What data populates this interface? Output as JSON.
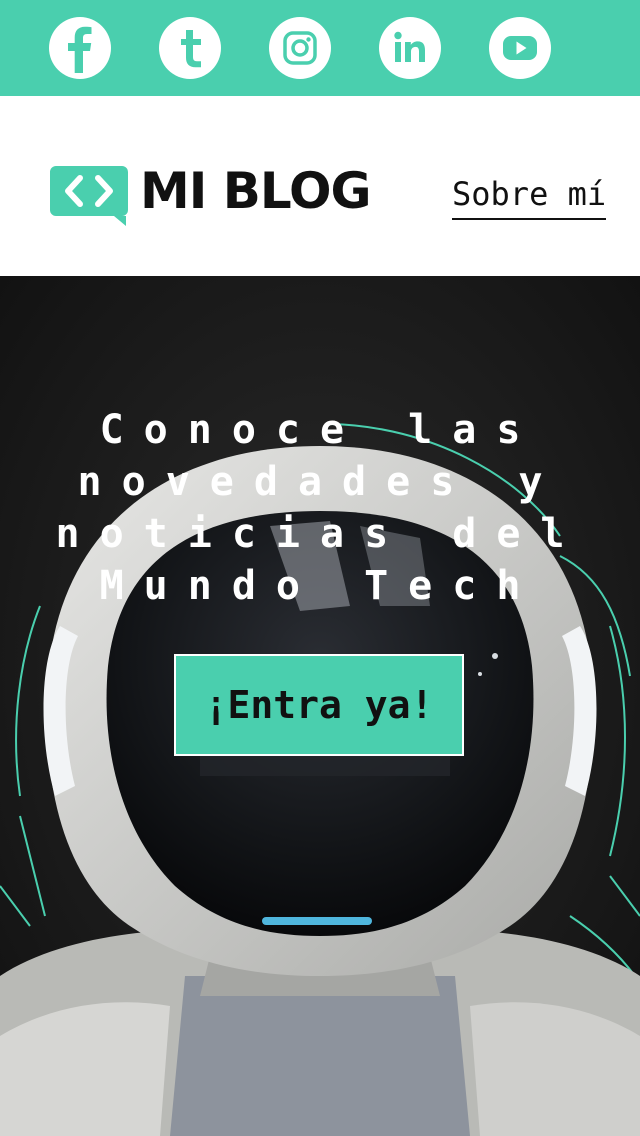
{
  "social": {
    "items": [
      {
        "icon": "facebook-icon"
      },
      {
        "icon": "twitter-icon"
      },
      {
        "icon": "instagram-icon"
      },
      {
        "icon": "linkedin-icon"
      },
      {
        "icon": "youtube-icon"
      }
    ],
    "bar_color": "#4acfae"
  },
  "header": {
    "logo_text": "MI BLOG",
    "nav_link": "Sobre mí"
  },
  "hero": {
    "title": "Conoce las novedades y noticias del Mundo Tech",
    "cta_label": "¡Entra ya!",
    "accent_color": "#4acfae"
  }
}
